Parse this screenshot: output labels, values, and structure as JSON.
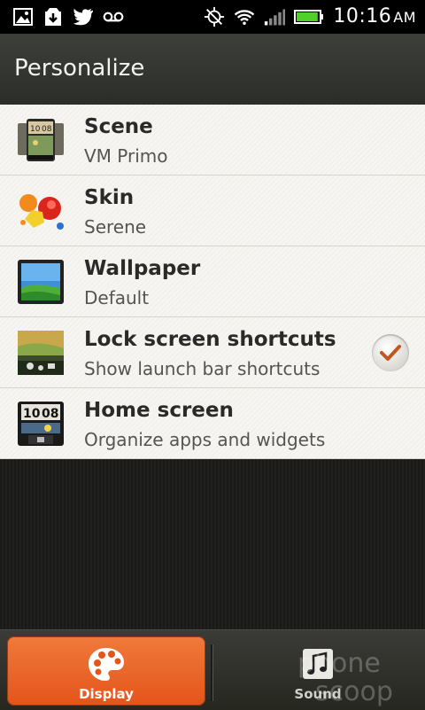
{
  "status_bar": {
    "time": "10:16",
    "ampm": "AM",
    "left_icons": [
      "gallery-icon",
      "download-icon",
      "twitter-icon",
      "voicemail-icon"
    ],
    "right_icons": [
      "gps-icon",
      "wifi-icon",
      "signal-icon",
      "battery-icon"
    ],
    "battery_level": 0.95
  },
  "header": {
    "title": "Personalize"
  },
  "list": {
    "items": [
      {
        "title": "Scene",
        "subtitle": "VM Primo",
        "icon": "scene-icon"
      },
      {
        "title": "Skin",
        "subtitle": "Serene",
        "icon": "skin-icon"
      },
      {
        "title": "Wallpaper",
        "subtitle": "Default",
        "icon": "wallpaper-icon"
      },
      {
        "title": "Lock screen shortcuts",
        "subtitle": "Show launch bar shortcuts",
        "icon": "lockscreen-icon",
        "checked": true
      },
      {
        "title": "Home screen",
        "subtitle": "Organize apps and widgets",
        "icon": "homescreen-icon"
      }
    ]
  },
  "tabs": {
    "display": {
      "label": "Display",
      "active": true
    },
    "sound": {
      "label": "Sound",
      "active": false
    }
  },
  "watermark": {
    "text": "phone scoop"
  },
  "colors": {
    "accent": "#e4541b",
    "check": "#c2561f"
  }
}
